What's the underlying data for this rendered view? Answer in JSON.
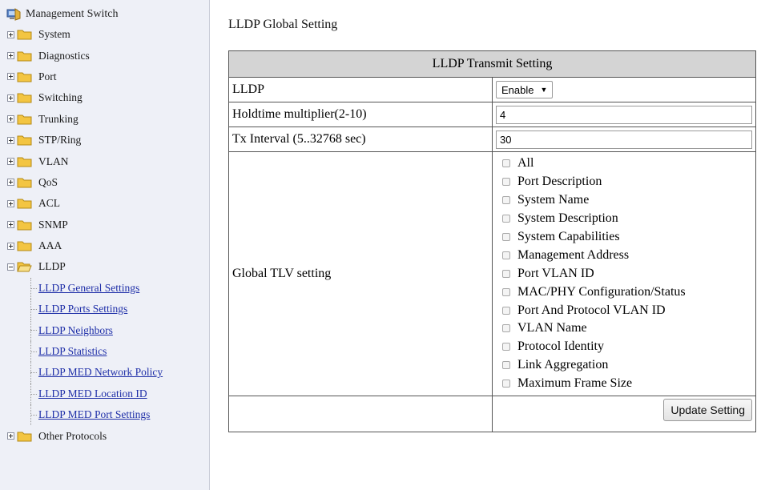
{
  "sidebar": {
    "root_label": "Management Switch",
    "nodes": [
      {
        "label": "System"
      },
      {
        "label": "Diagnostics"
      },
      {
        "label": "Port"
      },
      {
        "label": "Switching"
      },
      {
        "label": "Trunking"
      },
      {
        "label": "STP/Ring"
      },
      {
        "label": "VLAN"
      },
      {
        "label": "QoS"
      },
      {
        "label": "ACL"
      },
      {
        "label": "SNMP"
      },
      {
        "label": "AAA"
      },
      {
        "label": "LLDP"
      },
      {
        "label": "Other Protocols"
      }
    ],
    "lldp_children": [
      {
        "label": "LLDP General Settings"
      },
      {
        "label": "LLDP Ports Settings"
      },
      {
        "label": "LLDP Neighbors"
      },
      {
        "label": "LLDP Statistics"
      },
      {
        "label": "LLDP MED Network Policy"
      },
      {
        "label": "LLDP MED Location ID"
      },
      {
        "label": "LLDP MED Port Settings"
      }
    ]
  },
  "main": {
    "page_title": "LLDP Global Setting",
    "table_header": "LLDP Transmit Setting",
    "rows": {
      "lldp": {
        "label": "LLDP",
        "value": "Enable"
      },
      "holdtime": {
        "label": "Holdtime multiplier(2-10)",
        "value": "4"
      },
      "tx_interval": {
        "label": "Tx Interval (5..32768 sec)",
        "value": "30"
      },
      "tlv": {
        "label": "Global TLV setting"
      }
    },
    "tlv_options": [
      {
        "label": "All",
        "checked": false
      },
      {
        "label": "Port Description",
        "checked": false
      },
      {
        "label": "System Name",
        "checked": false
      },
      {
        "label": "System Description",
        "checked": false
      },
      {
        "label": "System Capabilities",
        "checked": false
      },
      {
        "label": "Management Address",
        "checked": false
      },
      {
        "label": "Port VLAN ID",
        "checked": false
      },
      {
        "label": "MAC/PHY Configuration/Status",
        "checked": false
      },
      {
        "label": "Port And Protocol VLAN ID",
        "checked": false
      },
      {
        "label": "VLAN Name",
        "checked": false
      },
      {
        "label": "Protocol Identity",
        "checked": false
      },
      {
        "label": "Link Aggregation",
        "checked": false
      },
      {
        "label": "Maximum Frame Size",
        "checked": false
      }
    ],
    "update_button": "Update Setting"
  },
  "colors": {
    "sidebar_bg": "#eef0f7",
    "link": "#1f2fa8",
    "folder": "#f3c542",
    "header_bg": "#d4d4d4"
  },
  "icons": {
    "root": "switch-computer-icon",
    "folder": "folder-icon",
    "folder_open": "folder-open-icon",
    "expand": "plus-box-icon",
    "collapse": "minus-box-icon"
  }
}
